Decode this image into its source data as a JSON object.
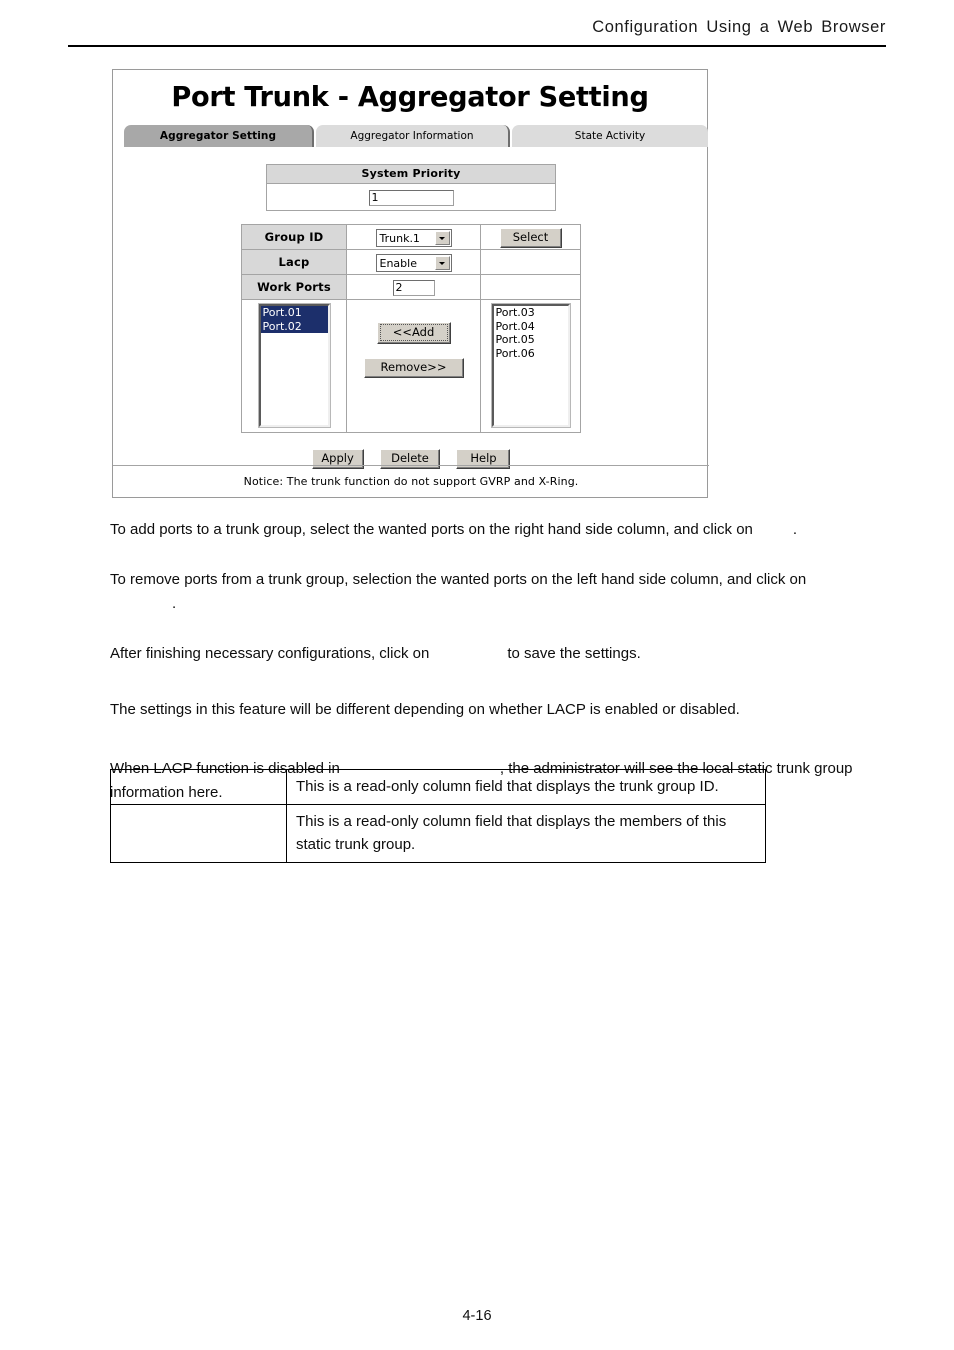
{
  "page": {
    "running_header": "Configuration Using a Web Browser",
    "page_number": "4-16"
  },
  "webui": {
    "title": "Port Trunk - Aggregator Setting",
    "tabs": [
      {
        "label": "Aggregator Setting",
        "active": true
      },
      {
        "label": "Aggregator Information",
        "active": false
      },
      {
        "label": "State Activity",
        "active": false
      }
    ],
    "system_priority": {
      "header": "System Priority",
      "value": "1"
    },
    "settings": {
      "group_id_label": "Group ID",
      "group_id_value": "Trunk.1",
      "select_button": "Select",
      "lacp_label": "Lacp",
      "lacp_value": "Enable",
      "work_ports_label": "Work Ports",
      "work_ports_value": "2"
    },
    "transfer": {
      "member_ports": [
        {
          "name": "Port.01",
          "selected": true
        },
        {
          "name": "Port.02",
          "selected": true
        }
      ],
      "add_button": "<<Add",
      "remove_button": "Remove>>",
      "available_ports": [
        {
          "name": "Port.03",
          "selected": false
        },
        {
          "name": "Port.04",
          "selected": false
        },
        {
          "name": "Port.05",
          "selected": false
        },
        {
          "name": "Port.06",
          "selected": false
        }
      ]
    },
    "actions": {
      "apply": "Apply",
      "delete": "Delete",
      "help": "Help"
    },
    "notice": "Notice: The trunk function do not support GVRP and X-Ring."
  },
  "body": {
    "p1_a": "To add ports to a trunk group, select the wanted ports on the right hand side column, and click on",
    "p1_b": ".",
    "p2_a": "To remove ports from a trunk group, selection the wanted ports on the left hand side column, and click on",
    "p2_b": ".",
    "p3_a": "After finishing necessary configurations, click on",
    "p3_b": "to save the settings.",
    "p4": "The settings in this feature will be different depending on whether LACP is enabled or disabled.",
    "p5_a": "When LACP function is disabled in",
    "p5_b": ", the administrator will see the local static trunk group information here."
  },
  "desc_table": {
    "rows": [
      {
        "term": "",
        "description": "This is a read-only column field that displays the trunk group ID."
      },
      {
        "term": "",
        "description": "This is a read-only column field that displays the members of this static trunk group."
      }
    ]
  }
}
